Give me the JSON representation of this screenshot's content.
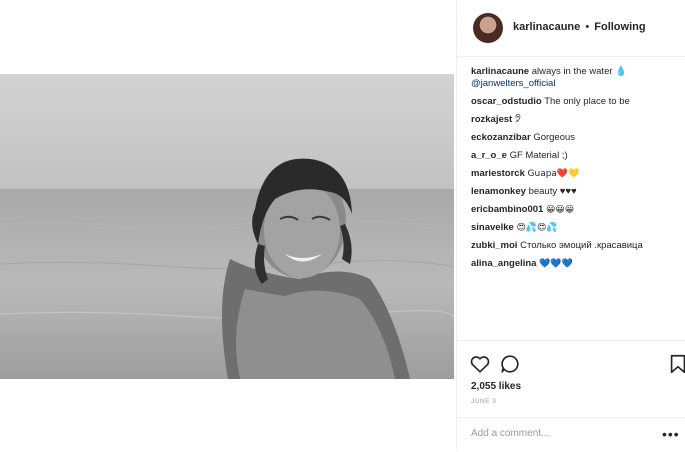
{
  "post": {
    "username": "karlinacaune",
    "separator": "•",
    "follow_status": "Following"
  },
  "caption": {
    "username": "karlinacaune",
    "text": "always in the water 💧",
    "mention": "@janwelters_official"
  },
  "comments": [
    {
      "user": "oscar_odstudio",
      "text": "The only place to be"
    },
    {
      "user": "rozkajest",
      "text": "🤋"
    },
    {
      "user": "eckozanzibar",
      "text": "Gorgeous"
    },
    {
      "user": "a_r_o_e",
      "text": "GF Material ;)"
    },
    {
      "user": "mariestorck",
      "text": "Guapa❤️💛"
    },
    {
      "user": "lenamonkey",
      "text": "beauty ♥♥♥"
    },
    {
      "user": "ericbambino001",
      "text": "😀😀😀"
    },
    {
      "user": "sinavelke",
      "text": "😍💦😍💦"
    },
    {
      "user": "zubki_moi",
      "text": "Столько эмоций .красавица"
    },
    {
      "user": "alina_angelina",
      "text": "💙💙💙"
    }
  ],
  "likes": "2,055 likes",
  "date": "JUNE 3",
  "add_comment": {
    "placeholder": "Add a comment..."
  },
  "more_label": "•••",
  "icons": {
    "like": "heart-icon",
    "comment": "comment-bubble-icon",
    "save": "bookmark-icon",
    "more": "ellipsis-icon"
  }
}
